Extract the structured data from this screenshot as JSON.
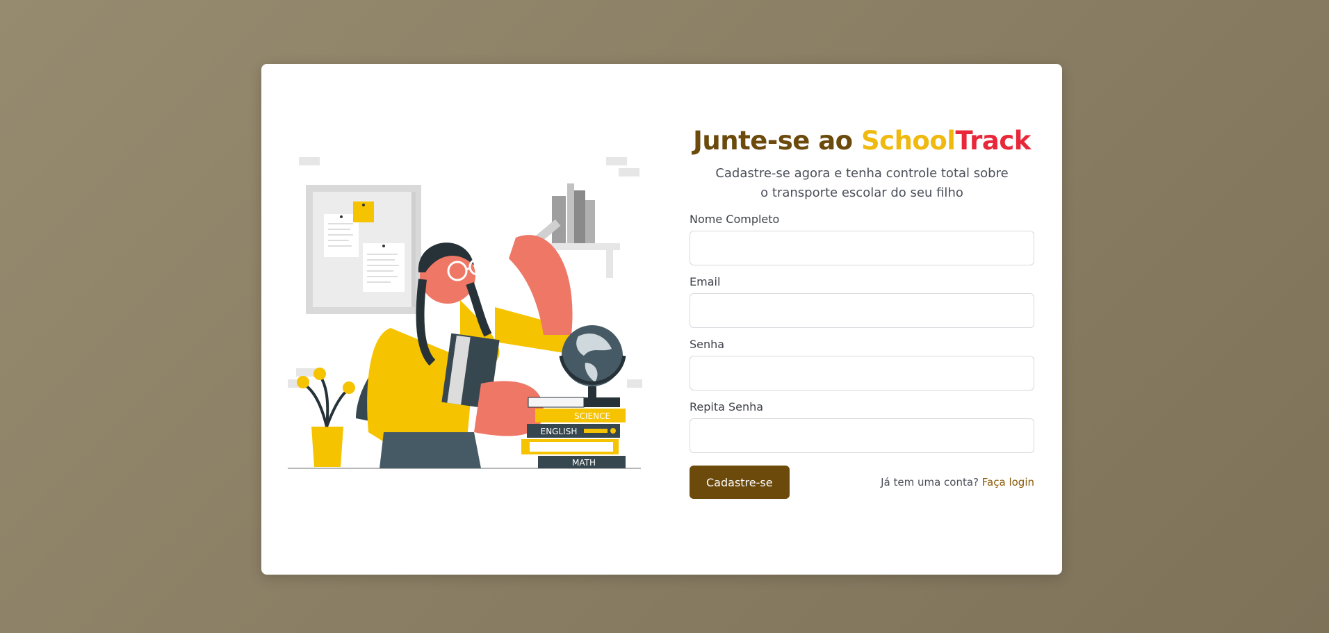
{
  "heading": {
    "prefix": "Junte-se ao ",
    "brand_part1": "School",
    "brand_part2": "Track"
  },
  "subtitle": "Cadastre-se agora e tenha controle total sobre o transporte escolar do seu filho",
  "fields": [
    {
      "label": "Nome Completo",
      "value": "",
      "placeholder": ""
    },
    {
      "label": "Email",
      "value": "",
      "placeholder": ""
    },
    {
      "label": "Senha",
      "value": "",
      "placeholder": ""
    },
    {
      "label": "Repita Senha",
      "value": "",
      "placeholder": ""
    }
  ],
  "submit_label": "Cadastre-se",
  "login_prompt": "Já tem uma conta?",
  "login_link": "Faça login",
  "illustration": {
    "book_labels": [
      "SCIENCE",
      "ENGLISH",
      "MATH"
    ]
  },
  "colors": {
    "brand_brown": "#6b4a0c",
    "brand_yellow": "#f0b90f",
    "brand_red": "#e8283a",
    "background": "#8a7e64"
  }
}
